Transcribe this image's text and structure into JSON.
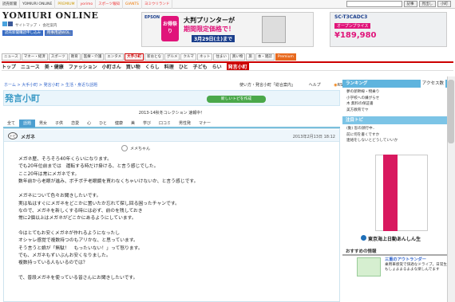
{
  "top_bar": {
    "tabs": [
      "読売新聞",
      "YOMIURI ONLINE",
      "PREMIUM",
      "yorimo",
      "スポーツ報知",
      "GIANTS",
      "ヨミウリランド"
    ],
    "search_buttons": [
      "記事",
      "見出し",
      "小町"
    ]
  },
  "header": {
    "logo": "YOMIURI ONLINE",
    "links": [
      "サイトマップ",
      "会社案内"
    ],
    "pills": [
      "読売新聞購読申し込み",
      "時事用語WOL"
    ]
  },
  "ads": {
    "epson_title": "大判プリンターが",
    "epson_sub": "期間限定価格で！",
    "epson_date": "3月29日(土)まで",
    "otoku": "お得祭り",
    "model": "SC-T3CADC3",
    "price": "¥189,980",
    "campaign": "オープンプライス"
  },
  "nav_primary": [
    "ニュース",
    "マネー・経済",
    "スポーツ",
    "教育",
    "医療・介護",
    "エンタメ",
    "大手小町",
    "新おとな",
    "グルメ",
    "クルマ",
    "ネット",
    "住まい",
    "買い物",
    "旅",
    "本・雑誌",
    "Premium"
  ],
  "nav_secondary": [
    "トップ",
    "ニュース",
    "美・健康",
    "ファッション",
    "小町さん",
    "買い物",
    "くらし",
    "料理",
    "ひと",
    "子ども",
    "らい"
  ],
  "nav_secondary_highlight": "発言小町",
  "breadcrumb": "ホーム > 大手小町 > 発言小町 > 生活・身近な話題",
  "toplinks": [
    "使い方・発言小町「総合案内」",
    "ヘルプ",
    "RSS"
  ],
  "hatsugen": {
    "logo": "発言小町",
    "new_topic": "新しいトピを作成"
  },
  "collection": "2013-14秋冬コレクション 速報中！",
  "categories": [
    "全て",
    "話題",
    "男女",
    "子供",
    "恋愛",
    "心",
    "ひと",
    "健康",
    "美",
    "学び",
    "口コミ",
    "男性発",
    "マナー"
  ],
  "topic": {
    "title": "メガネ",
    "date": "2013年2月13日 18:12",
    "author": "メメちゃん",
    "paragraphs": [
      "メガネ歴、そろそろ40年くらいになります。",
      "でも20年位前までは　運転する時だけ掛ける、と言う感じでした。",
      "ここ20年は常にメガネです。",
      "数年前から老眼が進み、ボチボチ老眼鏡を買わなくちゃいけないか、と言う感じです。",
      "",
      "メガネについて色々お聞きしたいです。",
      "実は私はすぐにメガネをどこかに置いたか忘れて探し回る困ったチャンです。",
      "なので、メガネを新しくする時には必ず、前のを残しておき",
      "常に2個以上はメガネがどこかにあるようにしています。",
      "",
      "今はとてもお安くメガネが作れるようになったし",
      "オシャレ感覚で複数持つのもアリかな、と思っています。",
      "そう言うと娘が「無駄！　もったいない！」って怒ります。",
      "でも、メガネもずいぶんお安くなりました。",
      "複数持っている人もいるのでは？",
      "",
      "で、普段メガネを使っている皆さんにお聞きしたいです。"
    ]
  },
  "sidebar": {
    "ranking_title": "ランキング",
    "ranking_tab": "アクセス数",
    "ranking": [
      "夢の新幹線・物乗り",
      "小学校への嫌がらせ",
      "木 無料の保証書",
      "美方教育でヤ"
    ],
    "trend_title": "注目トピ",
    "trend": [
      "(動) 窓の顔行中..",
      "前に何を書くですか",
      "連絡をしないとどうしていいか"
    ],
    "insurance": "東京海上日動あんしん生",
    "osusume_title": "おすすめの情報",
    "osusume_heading": "三重のアウトランダー",
    "osusume_body": "乗用車感覚で快適なドライブ。日常生活にもしょよよるよよな楽しんでます"
  }
}
